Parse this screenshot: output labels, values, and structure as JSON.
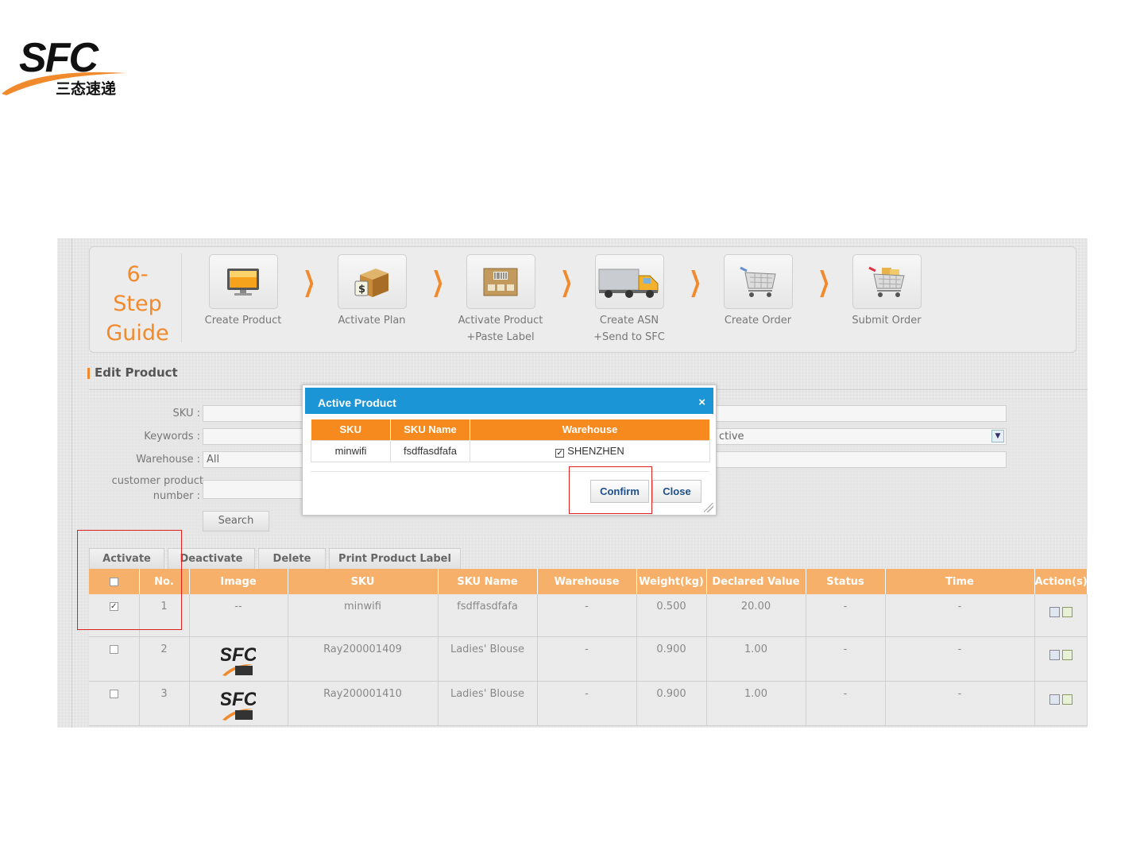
{
  "logo": {
    "text": "SFC",
    "subtitle": "三态速递"
  },
  "guide": {
    "title": "6-Step Guide",
    "steps": [
      {
        "label": "Create Product",
        "icon": "monitor-icon"
      },
      {
        "label": "Activate Plan",
        "icon": "package-dollar-icon"
      },
      {
        "label": "Activate Product\n+Paste Label",
        "icon": "barcode-box-icon"
      },
      {
        "label": "Create ASN\n+Send to SFC",
        "icon": "truck-icon"
      },
      {
        "label": "Create Order",
        "icon": "shopping-cart-icon"
      },
      {
        "label": "Submit Order",
        "icon": "cart-full-icon"
      }
    ]
  },
  "edit": {
    "title": "Edit Product",
    "sku_label": "SKU :",
    "keywords_label": "Keywords :",
    "warehouse_label": "Warehouse :",
    "warehouse_value": "All",
    "customer_label_1": "customer product",
    "customer_label_2": "number :",
    "status_partial": "ctive",
    "search_label": "Search"
  },
  "actions": {
    "activate": "Activate",
    "deactivate": "Deactivate",
    "delete": "Delete",
    "print": "Print Product Label"
  },
  "table": {
    "headers": [
      "No.",
      "Image",
      "SKU",
      "SKU Name",
      "Warehouse",
      "Weight(kg)",
      "Declared Value",
      "Status",
      "Time",
      "Action(s)"
    ],
    "rows": [
      {
        "checked": true,
        "no": "1",
        "image": "--",
        "sku": "minwifi",
        "name": "fsdffasdfafa",
        "warehouse": "-",
        "weight": "0.500",
        "value": "20.00",
        "status": "-",
        "time": "-"
      },
      {
        "checked": false,
        "no": "2",
        "image": "SFC",
        "sku": "Ray200001409",
        "name": "Ladies' Blouse",
        "warehouse": "-",
        "weight": "0.900",
        "value": "1.00",
        "status": "-",
        "time": "-"
      },
      {
        "checked": false,
        "no": "3",
        "image": "SFC",
        "sku": "Ray200001410",
        "name": "Ladies' Blouse",
        "warehouse": "-",
        "weight": "0.900",
        "value": "1.00",
        "status": "-",
        "time": "-"
      }
    ]
  },
  "modal": {
    "title": "Active Product",
    "close_glyph": "×",
    "headers": [
      "SKU",
      "SKU Name",
      "Warehouse"
    ],
    "row": {
      "sku": "minwifi",
      "name": "fsdffasdfafa",
      "warehouse": "SHENZHEN",
      "checked": true
    },
    "confirm": "Confirm",
    "close": "Close"
  },
  "colors": {
    "accent": "#f08a2c",
    "modal_header": "#1c95d6",
    "table_header": "#f7b06a",
    "highlight": "#e0201c"
  }
}
